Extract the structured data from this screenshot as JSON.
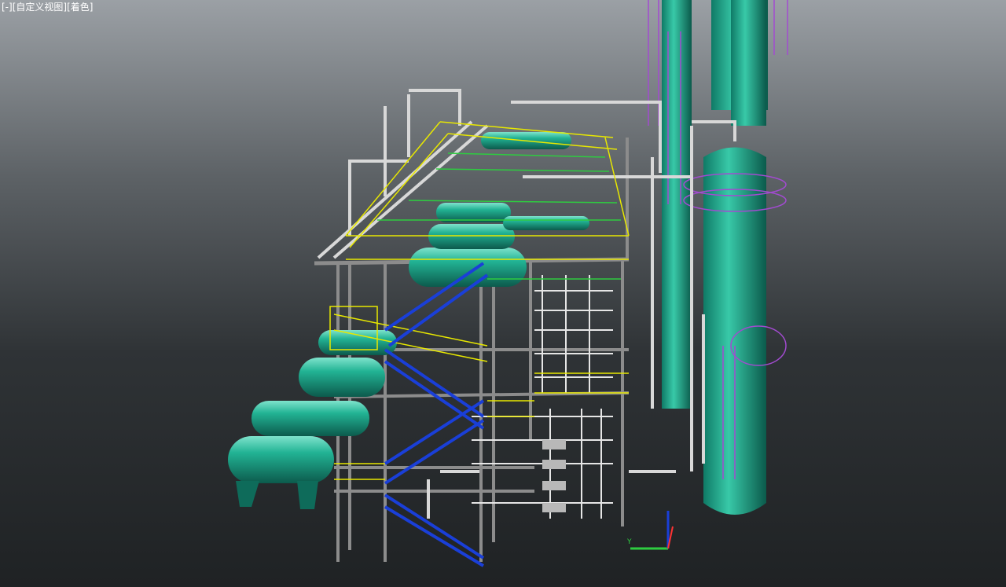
{
  "viewport": {
    "label": "[-][自定义视图][着色]"
  },
  "colors": {
    "equipment": "#1fa38a",
    "pipe": "#d8d8d8",
    "handrail": "#e8e800",
    "stair": "#1a3fd8",
    "ladder": "#a24bd0",
    "steel": "#8c8c8c"
  },
  "axis": {
    "x_color": "#2ecc40",
    "y_color": "#1a3fd8",
    "z_color": "#ff3333"
  }
}
